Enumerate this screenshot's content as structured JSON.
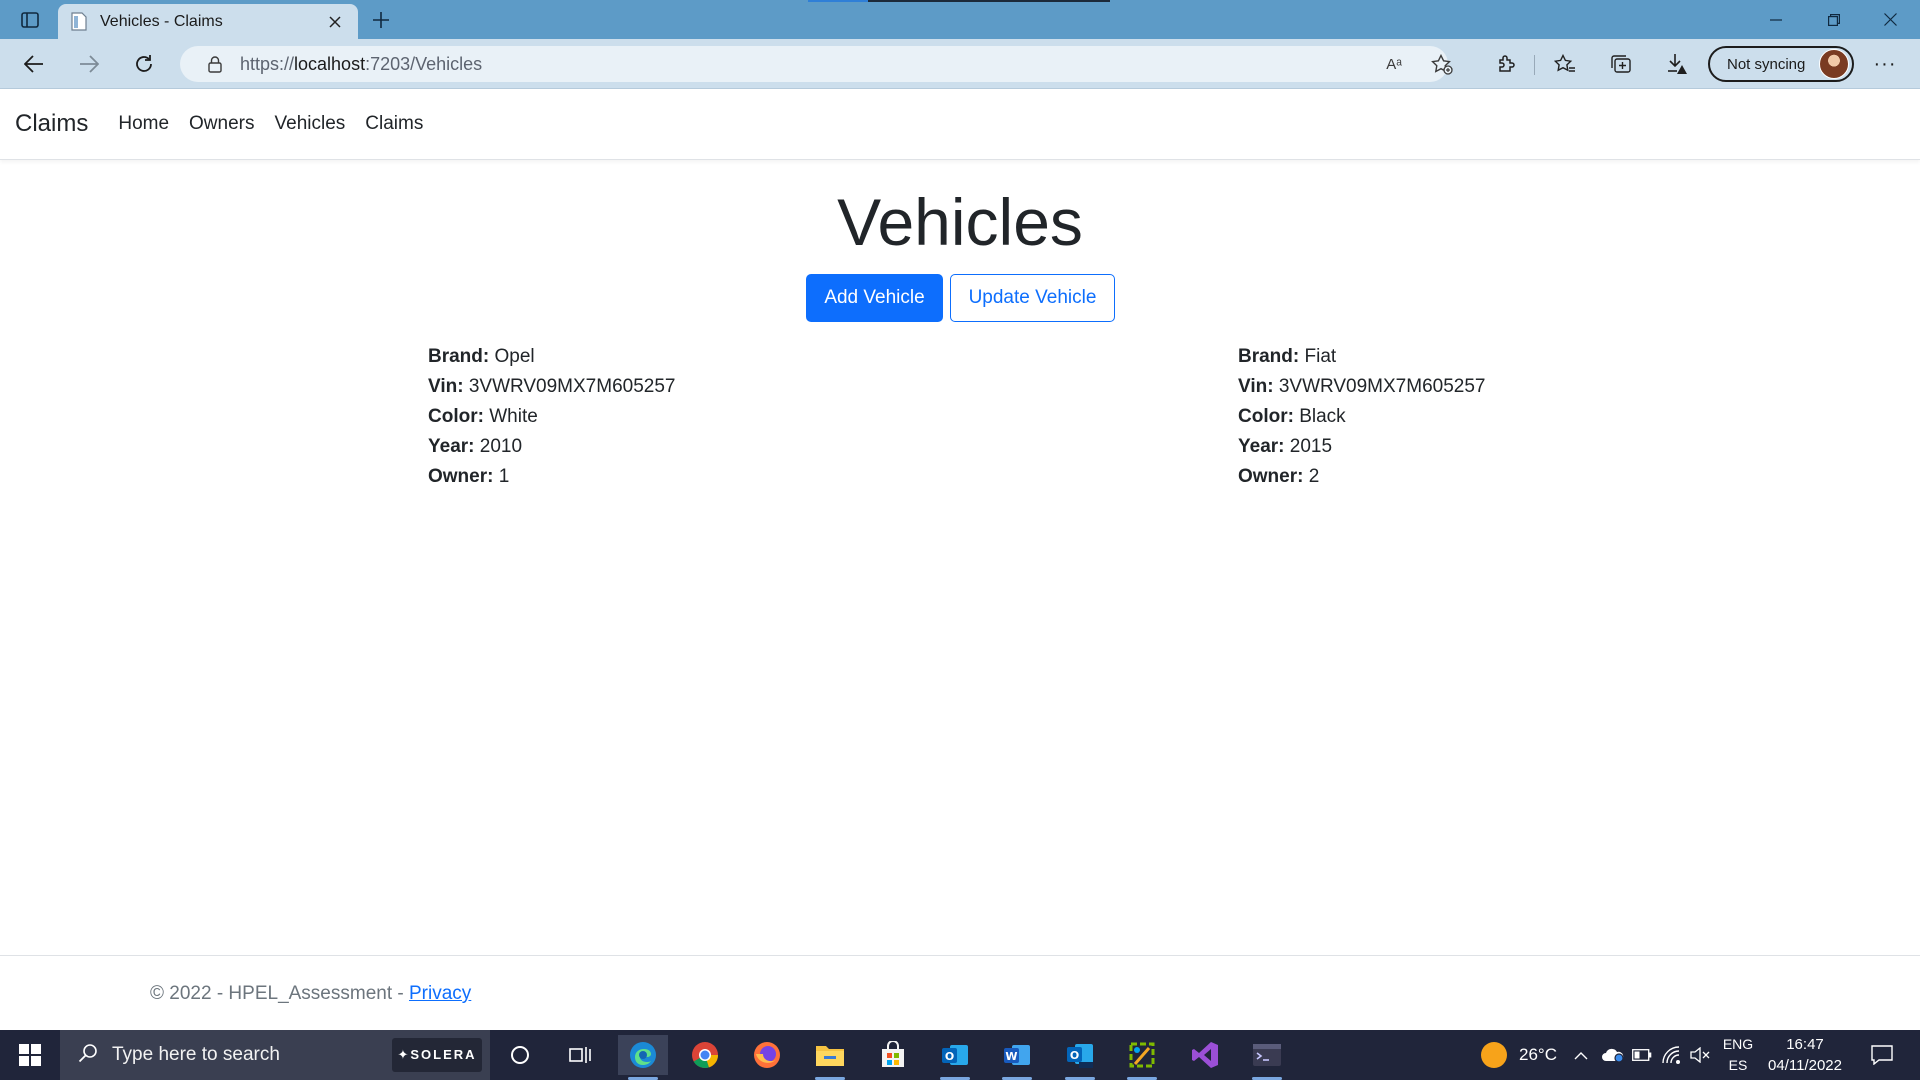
{
  "browser": {
    "tab_title": "Vehicles - Claims",
    "url_prefix": "https://",
    "url_host": "localhost",
    "url_path": ":7203/Vehicles",
    "read_aloud_label": "Aᵃ",
    "sync_label": "Not syncing",
    "more_label": "···"
  },
  "nav": {
    "brand": "Claims",
    "links": [
      "Home",
      "Owners",
      "Vehicles",
      "Claims"
    ]
  },
  "main": {
    "title": "Vehicles",
    "add_button": "Add Vehicle",
    "update_button": "Update Vehicle"
  },
  "labels": {
    "brand": "Brand:",
    "vin": "Vin:",
    "color": "Color:",
    "year": "Year:",
    "owner": "Owner:"
  },
  "vehicles": [
    {
      "brand": "Opel",
      "vin": "3VWRV09MX7M605257",
      "color": "White",
      "year": "2010",
      "owner": "1"
    },
    {
      "brand": "Fiat",
      "vin": "3VWRV09MX7M605257",
      "color": "Black",
      "year": "2015",
      "owner": "2"
    }
  ],
  "footer": {
    "text": "© 2022 - HPEL_Assessment - ",
    "privacy": "Privacy"
  },
  "taskbar": {
    "search_placeholder": "Type here to search",
    "search_widget": "✦SOLERA",
    "temperature": "26°C",
    "lang_top": "ENG",
    "lang_bottom": "ES",
    "time": "16:47",
    "date": "04/11/2022"
  },
  "colors": {
    "primary": "#0d6efd",
    "tabbar": "#5d9bc7",
    "addrbar": "#ccdeec",
    "taskbar": "#20253a"
  }
}
